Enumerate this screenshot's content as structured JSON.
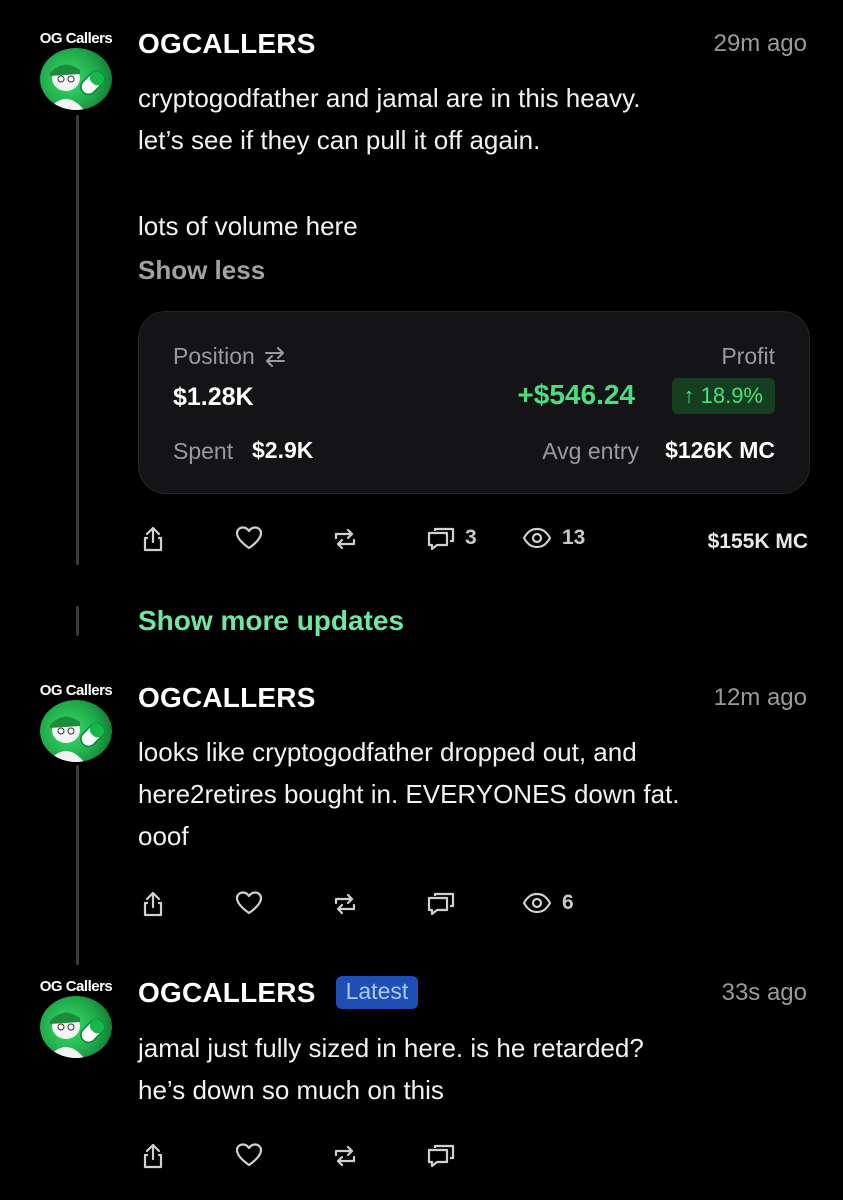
{
  "posts": [
    {
      "logo_text": "OG Callers",
      "username": "OGCALLERS",
      "time": "29m ago",
      "lines": [
        "cryptogodfather and jamal are in this heavy.",
        "let’s see if they can pull it off again.",
        "lots of volume here"
      ],
      "show_less": "Show less",
      "card": {
        "position_label": "Position",
        "position_value": "$1.28K",
        "profit_label": "Profit",
        "profit_value": "+$546.24",
        "profit_pct": "↑ 18.9%",
        "spent_label": "Spent",
        "spent_value": "$2.9K",
        "avg_label": "Avg entry",
        "avg_value": "$126K MC"
      },
      "comments": "3",
      "views": "13",
      "market_cap": "$155K MC"
    },
    {
      "logo_text": "OG Callers",
      "username": "OGCALLERS",
      "time": "12m ago",
      "lines": [
        "looks like cryptogodfather dropped out, and",
        "here2retires bought in. EVERYONES down fat.",
        "ooof"
      ],
      "views": "6"
    },
    {
      "logo_text": "OG Callers",
      "username": "OGCALLERS",
      "badge": "Latest",
      "time": "33s ago",
      "lines": [
        "jamal just fully sized in here. is he retarded?",
        "he’s down so much on this"
      ]
    }
  ],
  "show_more": "Show more updates",
  "colors": {
    "background": "#000000",
    "accent_green": "#4ade80",
    "badge_blue": "#1f4fb4"
  },
  "icons": [
    "share-icon",
    "heart-icon",
    "repost-icon",
    "comment-icon",
    "eye-icon",
    "swap-icon"
  ]
}
